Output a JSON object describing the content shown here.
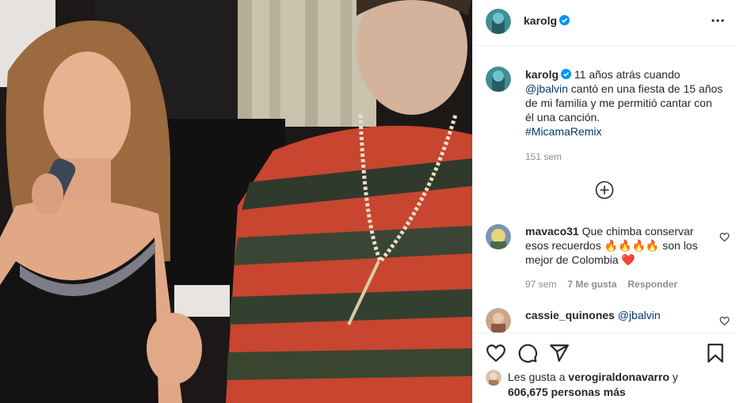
{
  "post_author": "karolg",
  "caption": {
    "username": "karolg",
    "text_before_mention": " 11 años atrás cuando",
    "mention": "@jbalvin",
    "text_after_mention": " cantó en una fiesta de 15 años de mi familia y me permitió cantar con él una canción.",
    "hashtag": "#MicamaRemix",
    "time": "151 sem"
  },
  "comments": [
    {
      "username": "mavaco31",
      "text_a": "Que chimba conservar esos recuerdos ",
      "emojis": "🔥🔥🔥🔥",
      "text_b": " son los mejor de Colombia ",
      "heart_emoji": "❤️",
      "time": "97 sem",
      "likes": "7 Me gusta",
      "reply": "Responder"
    },
    {
      "username": "cassie_quinones",
      "mention": "@jbalvin"
    }
  ],
  "likes": {
    "prefix": "Les gusta a ",
    "user": "verogiraldonavarro",
    "conj": " y",
    "count": "606,675 personas más"
  },
  "icons": {
    "verified": "verified-badge-icon",
    "more": "more-options-icon",
    "load_more": "plus-circle-icon",
    "like": "heart-icon",
    "comment": "comment-bubble-icon",
    "share": "paper-plane-icon",
    "save": "bookmark-icon"
  },
  "colors": {
    "verified_blue": "#0095f6",
    "link": "#00376b",
    "muted": "#8e8e8e"
  }
}
